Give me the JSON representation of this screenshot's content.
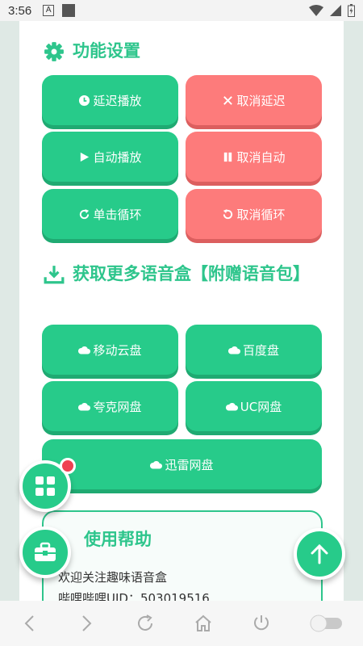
{
  "status_bar": {
    "time": "3:56",
    "indicator": "A"
  },
  "sections": {
    "settings_title": "功能设置",
    "download_title": "获取更多语音盒【附赠语音包】"
  },
  "settings_buttons": {
    "delay_play": "延迟播放",
    "cancel_delay": "取消延迟",
    "auto_play": "自动播放",
    "cancel_auto": "取消自动",
    "single_loop": "单击循环",
    "cancel_loop": "取消循环"
  },
  "download_buttons": {
    "mobile_cloud": "移动云盘",
    "baidu": "百度盘",
    "quark": "夸克网盘",
    "uc": "UC网盘",
    "xunlei": "迅雷网盘"
  },
  "help": {
    "title": "使用帮助",
    "line1": "欢迎关注趣味语音盒",
    "line2": "哔哩哔哩UID：503019516"
  },
  "colors": {
    "accent": "#27cb8a",
    "danger": "#fd7b7b",
    "badge": "#ef4152"
  },
  "icons": [
    "gear-icon",
    "download-icon",
    "clock-icon",
    "close-icon",
    "play-icon",
    "pause-icon",
    "redo-icon",
    "undo-icon",
    "cloud-icon",
    "grid-icon",
    "toolbox-icon",
    "arrow-up-icon",
    "back-icon",
    "forward-icon",
    "refresh-icon",
    "home-icon",
    "power-icon",
    "toggle-icon"
  ]
}
